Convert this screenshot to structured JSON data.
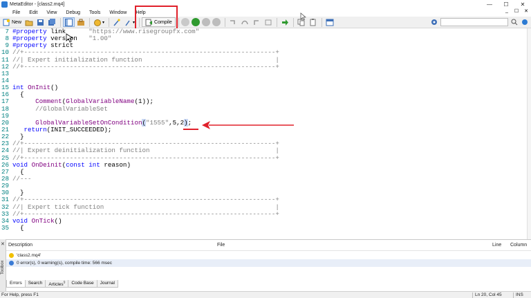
{
  "window": {
    "title": "MetaEditor - [class2.mq4]",
    "controls": [
      "—",
      "☐",
      "✕"
    ]
  },
  "menu": {
    "items": [
      "File",
      "Edit",
      "View",
      "Debug",
      "Tools",
      "Window",
      "Help"
    ],
    "right_controls": [
      "_",
      "☐",
      "✕"
    ]
  },
  "toolbar": {
    "new_label": "New",
    "compile_label": "Compile",
    "search_placeholder": ""
  },
  "editor": {
    "lines": [
      {
        "n": "7",
        "segs": [
          [
            "kw",
            "#property"
          ],
          [
            "pl",
            " link      "
          ],
          [
            "str",
            "\"https://www.risegroupfx.com\""
          ]
        ]
      },
      {
        "n": "8",
        "segs": [
          [
            "kw",
            "#property"
          ],
          [
            "pl",
            " version   "
          ],
          [
            "str",
            "\"1.00\""
          ]
        ]
      },
      {
        "n": "9",
        "segs": [
          [
            "kw",
            "#property"
          ],
          [
            "pl",
            " strict"
          ]
        ]
      },
      {
        "n": "10",
        "segs": [
          [
            "cm",
            "//+------------------------------------------------------------------+"
          ]
        ]
      },
      {
        "n": "11",
        "segs": [
          [
            "cm",
            "//| Expert initialization function                                   |"
          ]
        ]
      },
      {
        "n": "12",
        "segs": [
          [
            "cm",
            "//+------------------------------------------------------------------+"
          ]
        ]
      },
      {
        "n": "13",
        "segs": []
      },
      {
        "n": "14",
        "segs": []
      },
      {
        "n": "15",
        "segs": [
          [
            "kw",
            "int"
          ],
          [
            "pl",
            " "
          ],
          [
            "fn",
            "OnInit"
          ],
          [
            "pl",
            "()"
          ]
        ]
      },
      {
        "n": "16",
        "segs": [
          [
            "pl",
            "  {"
          ]
        ]
      },
      {
        "n": "17",
        "segs": [
          [
            "pl",
            "      "
          ],
          [
            "fn",
            "Comment"
          ],
          [
            "pl",
            "("
          ],
          [
            "fn",
            "GlobalVariableName"
          ],
          [
            "pl",
            "(1));"
          ]
        ]
      },
      {
        "n": "18",
        "segs": [
          [
            "cm",
            "      //GlobalVariableSet"
          ]
        ]
      },
      {
        "n": "19",
        "segs": []
      },
      {
        "n": "20",
        "segs": [
          [
            "pl",
            "      "
          ],
          [
            "fn",
            "GlobalVariableSetOnCondition"
          ],
          [
            "sel",
            "("
          ],
          [
            "str",
            "\"1555\""
          ],
          [
            "pl",
            ",5,2"
          ],
          [
            "sel",
            ")"
          ],
          [
            "pl",
            ";"
          ]
        ]
      },
      {
        "n": "21",
        "segs": [
          [
            "pl",
            "   "
          ],
          [
            "kw",
            "return"
          ],
          [
            "pl",
            "(INIT_SUCCEEDED);"
          ]
        ]
      },
      {
        "n": "22",
        "segs": [
          [
            "pl",
            "  }"
          ]
        ]
      },
      {
        "n": "23",
        "segs": [
          [
            "cm",
            "//+------------------------------------------------------------------+"
          ]
        ]
      },
      {
        "n": "24",
        "segs": [
          [
            "cm",
            "//| Expert deinitialization function                                 |"
          ]
        ]
      },
      {
        "n": "25",
        "segs": [
          [
            "cm",
            "//+------------------------------------------------------------------+"
          ]
        ]
      },
      {
        "n": "26",
        "segs": [
          [
            "kw",
            "void"
          ],
          [
            "pl",
            " "
          ],
          [
            "fn",
            "OnDeinit"
          ],
          [
            "pl",
            "("
          ],
          [
            "kw",
            "const"
          ],
          [
            "pl",
            " "
          ],
          [
            "kw",
            "int"
          ],
          [
            "pl",
            " reason)"
          ]
        ]
      },
      {
        "n": "27",
        "segs": [
          [
            "pl",
            "  {"
          ]
        ]
      },
      {
        "n": "28",
        "segs": [
          [
            "cm",
            "//---"
          ]
        ]
      },
      {
        "n": "29",
        "segs": []
      },
      {
        "n": "30",
        "segs": [
          [
            "pl",
            "  }"
          ]
        ]
      },
      {
        "n": "31",
        "segs": [
          [
            "cm",
            "//+------------------------------------------------------------------+"
          ]
        ]
      },
      {
        "n": "32",
        "segs": [
          [
            "cm",
            "//| Expert tick function                                             |"
          ]
        ]
      },
      {
        "n": "33",
        "segs": [
          [
            "cm",
            "//+------------------------------------------------------------------+"
          ]
        ]
      },
      {
        "n": "34",
        "segs": [
          [
            "kw",
            "void"
          ],
          [
            "pl",
            " "
          ],
          [
            "fn",
            "OnTick"
          ],
          [
            "pl",
            "()"
          ]
        ]
      },
      {
        "n": "35",
        "segs": [
          [
            "pl",
            "  {"
          ]
        ]
      }
    ]
  },
  "panel": {
    "columns": {
      "description": "Description",
      "file": "File",
      "line": "Line",
      "column": "Column"
    },
    "messages": [
      {
        "text": "'class2.mq4'",
        "icon_color": "#f0c000"
      },
      {
        "text": "0 error(s), 0 warning(s), compile time: 566 msec",
        "icon_color": "#3a7bd5"
      }
    ],
    "tabs": [
      "Errors",
      "Search",
      "Articles",
      "Code Base",
      "Journal"
    ],
    "tab_badge": "9",
    "toolbox_label": "Toolbox"
  },
  "status": {
    "help": "For Help, press F1",
    "position": "Ln 20, Col 45",
    "mode": "INS"
  },
  "colors": {
    "accent_red": "#e0202a",
    "keyword": "#0000ff",
    "function": "#800080",
    "comment": "#808080"
  }
}
